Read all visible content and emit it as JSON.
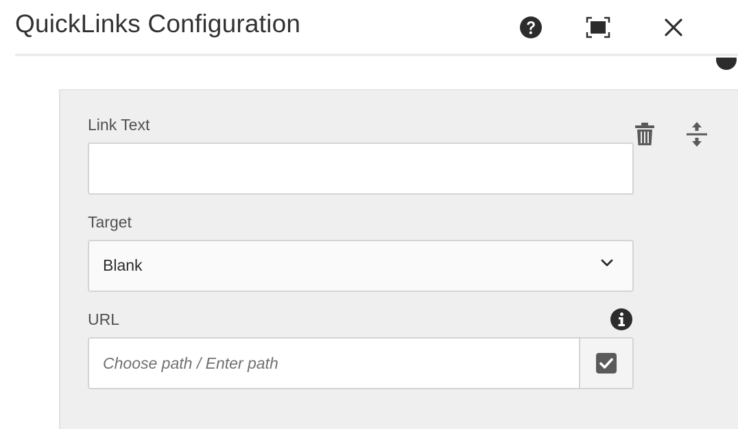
{
  "dialog": {
    "title": "QuickLinks Configuration",
    "icons": {
      "help": "help-icon",
      "fullscreen": "fullscreen-icon",
      "close": "close-icon"
    }
  },
  "item": {
    "link_text": {
      "label": "Link Text",
      "value": ""
    },
    "target": {
      "label": "Target",
      "selected": "Blank"
    },
    "url": {
      "label": "URL",
      "value": "",
      "placeholder": "Choose path / Enter path"
    },
    "icons": {
      "delete": "trash-icon",
      "reorder": "reorder-icon",
      "info": "info-icon",
      "picker": "checkbox-picker-icon"
    }
  },
  "colors": {
    "panel_background": "#efefef",
    "icon_dark": "#2c2c2c",
    "icon_gray": "#5a5a5a",
    "border": "#d4d4d4"
  }
}
